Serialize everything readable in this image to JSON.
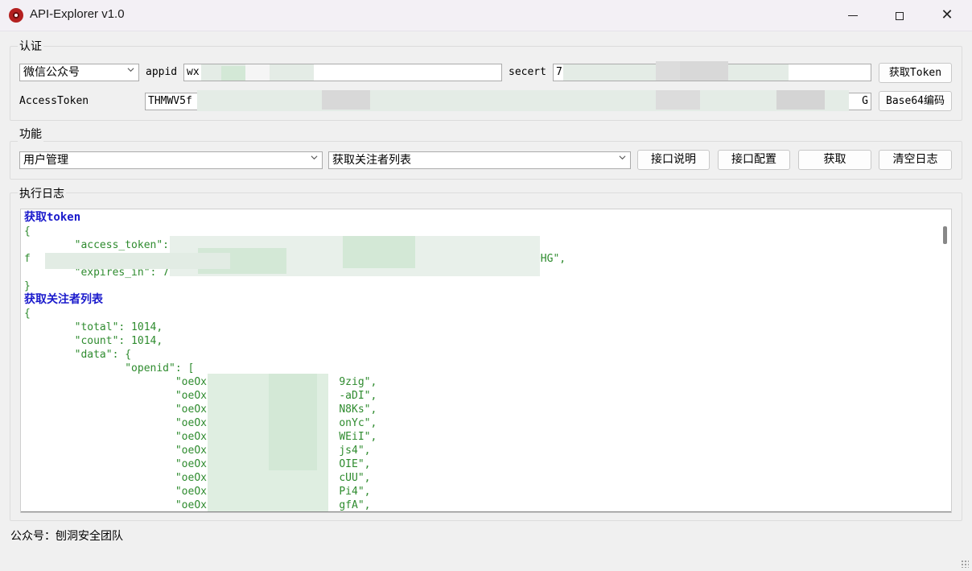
{
  "window": {
    "title": "API-Explorer v1.0",
    "icon": "app-gear-icon",
    "controls": [
      "minimize",
      "maximize",
      "close"
    ]
  },
  "auth": {
    "group_label": "认证",
    "platform_selected": "微信公众号",
    "appid_label": "appid",
    "appid_value": "wx",
    "secret_label": "secert",
    "secret_value": "7",
    "get_token_button": "获取Token",
    "access_token_label": "AccessToken",
    "access_token_value": "THMWV5f",
    "access_token_tail": "G",
    "base64_button": "Base64编码"
  },
  "function": {
    "group_label": "功能",
    "category_selected": "用户管理",
    "api_selected": "获取关注者列表",
    "buttons": {
      "doc": "接口说明",
      "config": "接口配置",
      "fetch": "获取",
      "clear": "清空日志"
    }
  },
  "log": {
    "group_label": "执行日志",
    "lines": [
      {
        "type": "header",
        "text": "获取token"
      },
      {
        "type": "code",
        "text": "{"
      },
      {
        "type": "code",
        "text": "        \"access_token\":                                                    WVTpk-"
      },
      {
        "type": "code",
        "text": "f                                                                          YBAAGAQHG\","
      },
      {
        "type": "code",
        "text": "        \"expires_in\": 7200"
      },
      {
        "type": "code",
        "text": "}"
      },
      {
        "type": "header",
        "text": "获取关注者列表"
      },
      {
        "type": "code",
        "text": "{"
      },
      {
        "type": "code",
        "text": "        \"total\": 1014,"
      },
      {
        "type": "code",
        "text": "        \"count\": 1014,"
      },
      {
        "type": "code",
        "text": "        \"data\": {"
      },
      {
        "type": "code",
        "text": "                \"openid\": ["
      },
      {
        "type": "code",
        "text": "                        \"oeOx-                    9zig\","
      },
      {
        "type": "code",
        "text": "                        \"oeOx-                    -aDI\","
      },
      {
        "type": "code",
        "text": "                        \"oeOx-                    N8Ks\","
      },
      {
        "type": "code",
        "text": "                        \"oeOx-                    onYc\","
      },
      {
        "type": "code",
        "text": "                        \"oeOx-                    WEiI\","
      },
      {
        "type": "code",
        "text": "                        \"oeOx-                    js4\","
      },
      {
        "type": "code",
        "text": "                        \"oeOx-                    OIE\","
      },
      {
        "type": "code",
        "text": "                        \"oeOx-                    cUU\","
      },
      {
        "type": "code",
        "text": "                        \"oeOx-                    Pi4\","
      },
      {
        "type": "code",
        "text": "                        \"oeOx-                    gfA\","
      }
    ]
  },
  "status_bar": {
    "text": "公众号：刨洞安全团队"
  },
  "colors": {
    "json_text": "#2e8b2e",
    "header_text": "#1a1acc",
    "window_bg": "#f0f0f0"
  }
}
